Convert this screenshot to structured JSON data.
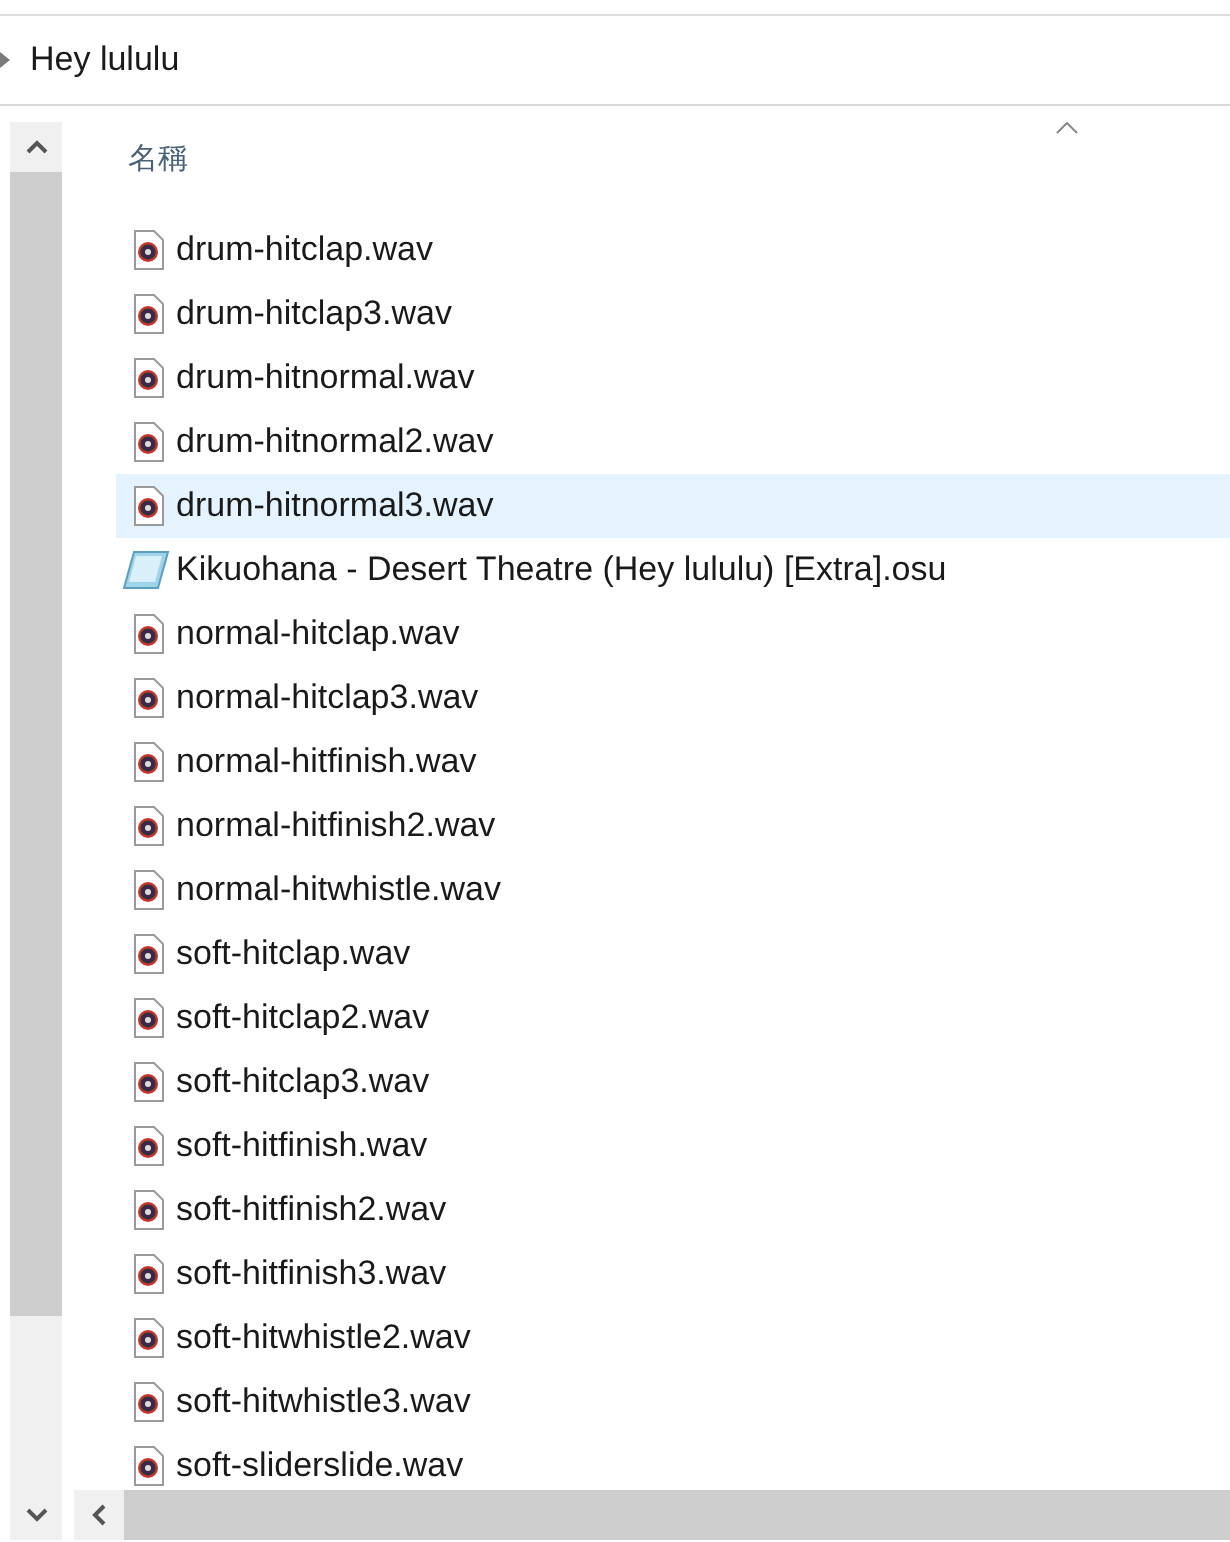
{
  "breadcrumb": {
    "label": "Hey lululu"
  },
  "list": {
    "column_header": "名稱",
    "items": [
      {
        "name": "drum-hitclap.wav",
        "kind": "audio",
        "selected": false
      },
      {
        "name": "drum-hitclap3.wav",
        "kind": "audio",
        "selected": false
      },
      {
        "name": "drum-hitnormal.wav",
        "kind": "audio",
        "selected": false
      },
      {
        "name": "drum-hitnormal2.wav",
        "kind": "audio",
        "selected": false
      },
      {
        "name": "drum-hitnormal3.wav",
        "kind": "audio",
        "selected": true
      },
      {
        "name": "Kikuohana - Desert Theatre (Hey lululu) [Extra].osu",
        "kind": "text",
        "selected": false
      },
      {
        "name": "normal-hitclap.wav",
        "kind": "audio",
        "selected": false
      },
      {
        "name": "normal-hitclap3.wav",
        "kind": "audio",
        "selected": false
      },
      {
        "name": "normal-hitfinish.wav",
        "kind": "audio",
        "selected": false
      },
      {
        "name": "normal-hitfinish2.wav",
        "kind": "audio",
        "selected": false
      },
      {
        "name": "normal-hitwhistle.wav",
        "kind": "audio",
        "selected": false
      },
      {
        "name": "soft-hitclap.wav",
        "kind": "audio",
        "selected": false
      },
      {
        "name": "soft-hitclap2.wav",
        "kind": "audio",
        "selected": false
      },
      {
        "name": "soft-hitclap3.wav",
        "kind": "audio",
        "selected": false
      },
      {
        "name": "soft-hitfinish.wav",
        "kind": "audio",
        "selected": false
      },
      {
        "name": "soft-hitfinish2.wav",
        "kind": "audio",
        "selected": false
      },
      {
        "name": "soft-hitfinish3.wav",
        "kind": "audio",
        "selected": false
      },
      {
        "name": "soft-hitwhistle2.wav",
        "kind": "audio",
        "selected": false
      },
      {
        "name": "soft-hitwhistle3.wav",
        "kind": "audio",
        "selected": false
      },
      {
        "name": "soft-sliderslide.wav",
        "kind": "audio",
        "selected": false
      }
    ]
  }
}
